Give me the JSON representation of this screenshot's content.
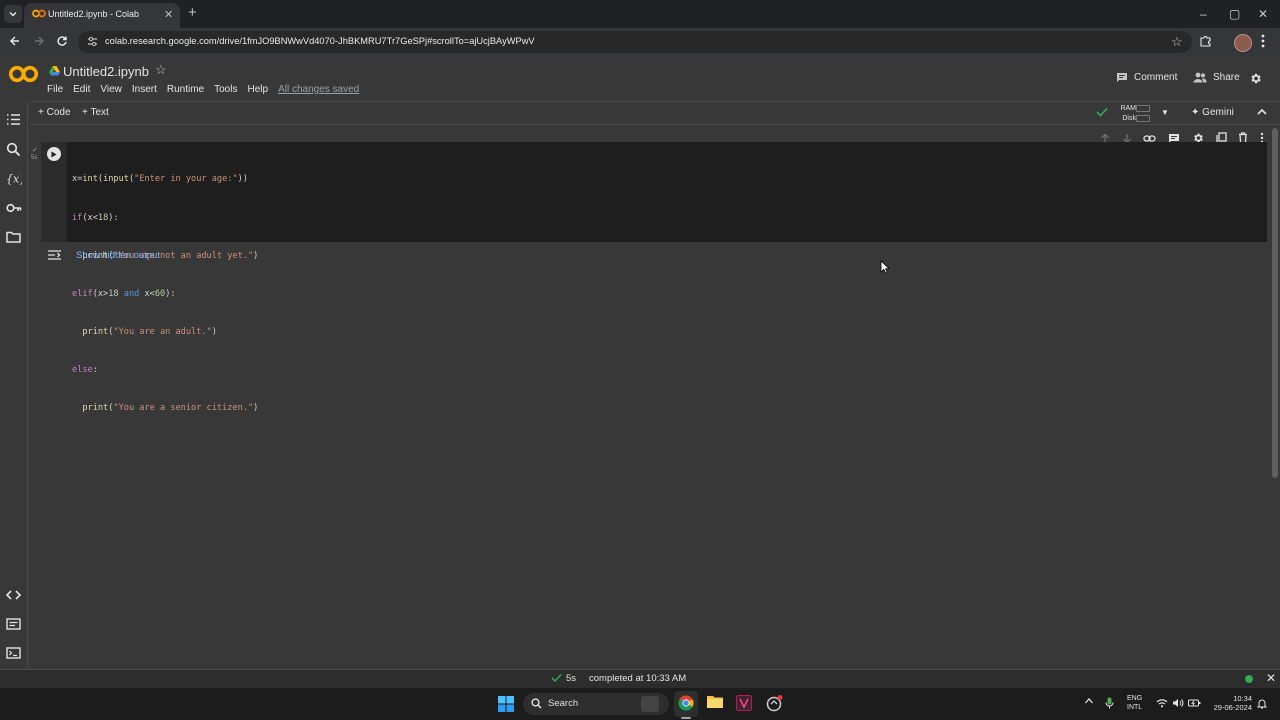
{
  "browser": {
    "tab_title": "Untitled2.ipynb - Colab",
    "tab_close": "✕",
    "new_tab": "+",
    "url": "colab.research.google.com/drive/1fmJO9BNWwVd4070-JhBKMRU7Tr7GeSPj#scrollTo=ajUcjBAyWPwV",
    "window_controls": {
      "minimize": "–",
      "restore": "▢",
      "close": "✕"
    }
  },
  "colab": {
    "notebook_title": "Untitled2.ipynb",
    "menu": [
      "File",
      "Edit",
      "View",
      "Insert",
      "Runtime",
      "Tools",
      "Help"
    ],
    "save_status": "All changes saved",
    "comment_label": "Comment",
    "share_label": "Share",
    "toolbar": {
      "add_code": "+ Code",
      "add_text": "+ Text",
      "ram_label": "RAM",
      "disk_label": "Disk",
      "gemini_label": "Gemini"
    },
    "cell": {
      "exec_check": "✓",
      "exec_time": "5s",
      "code_lines": [
        "x=int(input(\"Enter in your age:\"))",
        "if(x<18):",
        "  print(\"You are not an adult yet.\")",
        "elif(x>18 and x<60):",
        "  print(\"You are an adult.\")",
        "else:",
        "  print(\"You are a senior citizen.\")"
      ]
    },
    "show_hidden_output": "Show hidden output",
    "status": {
      "duration": "5s",
      "text": "completed at 10:33 AM"
    }
  },
  "taskbar": {
    "search_label": "Search",
    "lang_top": "ENG",
    "lang_bottom": "INTL",
    "time": "10:34",
    "date": "29-06-2024"
  },
  "icons": {
    "tab_favicon": "colab-logo-icon",
    "colab_logo": "colab-logo-icon",
    "drive": "google-drive-icon",
    "star": "star-icon",
    "settings": "gear-icon",
    "run": "play-icon"
  },
  "colors": {
    "colab_orange": "#f9ab00",
    "link_blue": "#8ab4f8",
    "status_green": "#34a853"
  }
}
